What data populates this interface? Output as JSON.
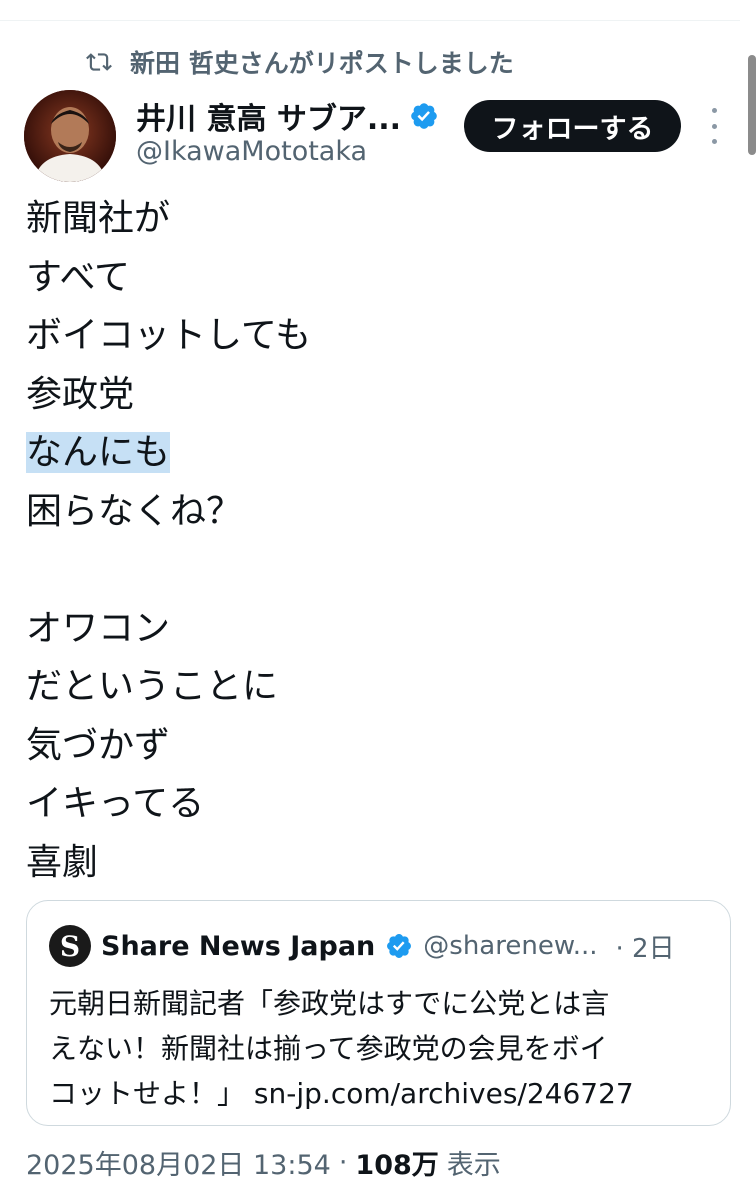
{
  "repost": {
    "text": "新田 哲史さんがリポストしました",
    "icon": "repost-icon"
  },
  "author": {
    "display_name": "井川 意高 サブア...",
    "handle": "@IkawaMototaka",
    "verified_icon": "verified-badge-icon",
    "verified_color": "#1d9bf0"
  },
  "follow_button": {
    "label": "フォローする"
  },
  "more_icon": "more-vertical-icon",
  "tweet": {
    "lines": [
      "新聞社が",
      "すべて",
      "ボイコットしても",
      "参政党",
      "なんにも",
      "困らなくね？",
      "",
      "オワコン",
      "だということに",
      "気づかず",
      "イキってる",
      "喜劇"
    ],
    "highlight_color": "#c6e0f5"
  },
  "quote": {
    "avatar_letter": "S",
    "name": "Share News Japan",
    "handle": "@sharenew...",
    "time": "· 2日",
    "text_line1": "元朝日新聞記者「参政党はすでに公党とは言",
    "text_line2": "えない！新聞社は揃って参政党の会見をボイ",
    "text_line3_prefix": "コットせよ！」",
    "url": "sn-jp.com/archives/246727"
  },
  "meta": {
    "timestamp": "2025年08月02日 13:54",
    "separator": "·",
    "views_count": "108万",
    "views_label": "表示"
  }
}
